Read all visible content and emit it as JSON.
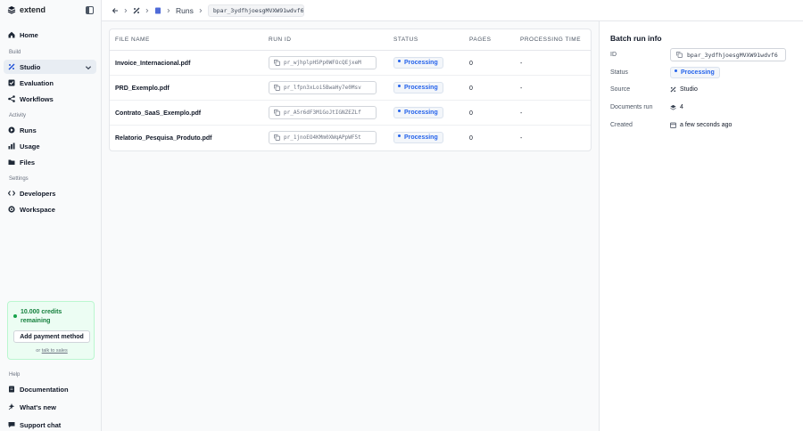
{
  "brand": {
    "name": "extend"
  },
  "sidebar": {
    "home": "Home",
    "sections": {
      "build": "Build",
      "activity": "Activity",
      "settings": "Settings",
      "help": "Help"
    },
    "build_items": [
      {
        "label": "Studio",
        "icon": "studio-icon",
        "active": true
      },
      {
        "label": "Evaluation",
        "icon": "evaluation-icon"
      },
      {
        "label": "Workflows",
        "icon": "workflows-icon"
      }
    ],
    "activity_items": [
      {
        "label": "Runs",
        "icon": "runs-icon"
      },
      {
        "label": "Usage",
        "icon": "usage-icon"
      },
      {
        "label": "Files",
        "icon": "files-icon"
      }
    ],
    "settings_items": [
      {
        "label": "Developers",
        "icon": "developers-icon"
      },
      {
        "label": "Workspace",
        "icon": "workspace-icon"
      }
    ],
    "help_items": [
      {
        "label": "Documentation",
        "icon": "documentation-icon"
      },
      {
        "label": "What's new",
        "icon": "whats-new-icon"
      },
      {
        "label": "Support chat",
        "icon": "support-chat-icon"
      }
    ],
    "credits": {
      "text": "10.000 credits remaining",
      "button": "Add payment method",
      "or_text": "or",
      "link_text": "talk to sales"
    }
  },
  "topbar": {
    "crumb_label": "Runs",
    "crumb_id": "bpar_3ydfhjoesgMVXW91wdvf6"
  },
  "table": {
    "headers": {
      "file_name": "FILE NAME",
      "run_id": "RUN ID",
      "status": "STATUS",
      "pages": "PAGES",
      "processing_time": "PROCESSING TIME"
    },
    "rows": [
      {
        "file_name": "Invoice_Internacional.pdf",
        "run_id": "pr_wjhplpH5Pp0WFOcQEjxeM",
        "status": "Processing",
        "pages": "0",
        "processing_time": "-"
      },
      {
        "file_name": "PRD_Exemplo.pdf",
        "run_id": "pr_lfpn3xLoi5BwaHy7e0Msv",
        "status": "Processing",
        "pages": "0",
        "processing_time": "-"
      },
      {
        "file_name": "Contrato_SaaS_Exemplo.pdf",
        "run_id": "pr_A5r6dF3M1GoJtIGNZEZLf",
        "status": "Processing",
        "pages": "0",
        "processing_time": "-"
      },
      {
        "file_name": "Relatorio_Pesquisa_Produto.pdf",
        "run_id": "pr_1jnoEO4KMm0XWqAPpWF5t",
        "status": "Processing",
        "pages": "0",
        "processing_time": "-"
      }
    ]
  },
  "panel": {
    "title": "Batch run info",
    "labels": {
      "id": "ID",
      "status": "Status",
      "source": "Source",
      "documents_run": "Documents run",
      "created": "Created"
    },
    "values": {
      "id": "bpar_3ydfhjoesgMVXW91wdvf6",
      "status": "Processing",
      "source": "Studio",
      "documents_run": "4",
      "created": "a few seconds ago"
    }
  },
  "colors": {
    "accent_blue": "#2563eb",
    "credits_green": "#16a34a"
  }
}
